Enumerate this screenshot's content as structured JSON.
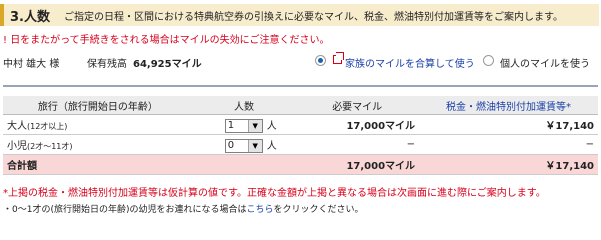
{
  "header": {
    "title": "3.人数",
    "description": "ご指定の日程・区間における特典航空券の引換えに必要なマイル、税金、燃油特別付加運賃等をご案内します。"
  },
  "warning": "! 日をまたがって手続きをされる場合はマイルの失効にご注意ください。",
  "member": {
    "name": "中村 雄大 様",
    "balance_label": "保有残高",
    "balance_value": "64,925マイル",
    "option_family": "家族のマイルを合算して使う",
    "option_individual": "個人のマイルを使う",
    "selected": "family"
  },
  "table": {
    "headers": {
      "category": "旅行（旅行開始日の年齢）",
      "count": "人数",
      "miles": "必要マイル",
      "fuel": "税金・燃油特別付加運賃等*"
    },
    "rows": [
      {
        "category": "大人",
        "age": "(12才以上)",
        "count": "1",
        "unit": "人",
        "miles": "17,000マイル",
        "fuel": "￥17,140"
      },
      {
        "category": "小児",
        "age": "(2才〜11才)",
        "count": "0",
        "unit": "人",
        "miles": "−",
        "fuel": "−"
      }
    ],
    "total": {
      "label": "合計額",
      "miles": "17,000マイル",
      "fuel": "￥17,140"
    }
  },
  "notes": {
    "tax_note": "*上掲の税金・燃油特別付加運賃等は仮計算の値です。正確な金額が上掲と異なる場合は次画面に進む際にご案内します。",
    "infant_prefix": "・0〜1才の(旅行開始日の年齢)の幼児をお連れになる場合は",
    "infant_link": "こちら",
    "infant_suffix": "をクリックください。"
  },
  "icons": {
    "dropdown": "chevron-down-icon",
    "family": "family-window-icon"
  },
  "colors": {
    "accent_gold": "#d9a827",
    "header_bg": "#f7eccc",
    "warning_red": "#d8001a",
    "link_blue": "#1a3fa8",
    "total_row_bg": "#f9d7d7"
  }
}
